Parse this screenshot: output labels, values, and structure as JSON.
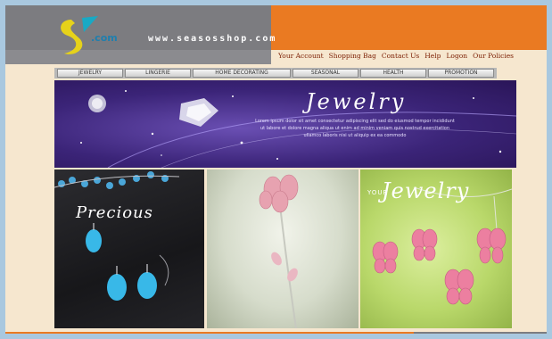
{
  "header": {
    "logo_text": ".com",
    "site_url": "www.seasosshop.com"
  },
  "top_nav": {
    "items": [
      {
        "label": "Your Account"
      },
      {
        "label": "Shopping Bag"
      },
      {
        "label": "Contact Us"
      },
      {
        "label": "Help"
      },
      {
        "label": "Logon"
      },
      {
        "label": "Our Policies"
      }
    ]
  },
  "category_tabs": {
    "items": [
      {
        "label": "Jewelry"
      },
      {
        "label": "Lingerie"
      },
      {
        "label": "Home Decorating"
      },
      {
        "label": "Seasonal"
      },
      {
        "label": "Health"
      },
      {
        "label": "Promotion"
      }
    ]
  },
  "banner": {
    "title": "Jewelry",
    "description": "Lorem ipsum dolor sit amet consectetur adipiscing elit sed do eiusmod tempor incididunt ut labore et dolore magna aliqua ut enim ad minim veniam quis nostrud exercitation ullamco laboris nisi ut aliquip ex ea commodo"
  },
  "panels": {
    "precious": {
      "title": "Precious"
    },
    "flower": {},
    "your_jewelry": {
      "prefix": "YOUR",
      "title": "Jewelry"
    }
  },
  "colors": {
    "orange": "#ea7a22",
    "gray": "#7c7c80",
    "cream": "#f6e7cf",
    "banner_purple": "#3b2478",
    "nav_text": "#7a1c00"
  }
}
